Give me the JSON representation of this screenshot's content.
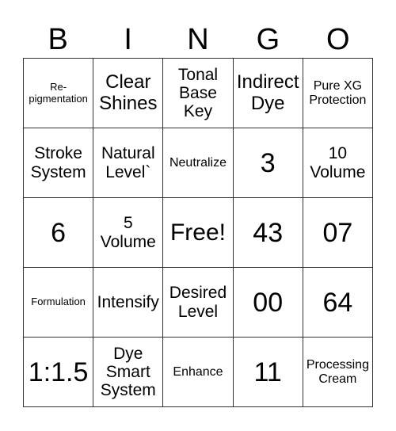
{
  "header": {
    "letters": [
      "B",
      "I",
      "N",
      "G",
      "O"
    ]
  },
  "cells": [
    [
      "Re-\npigmentation",
      "Clear Shines",
      "Tonal Base Key",
      "Indirect Dye",
      "Pure XG Protection"
    ],
    [
      "Stroke System",
      "Natural Level`",
      "Neutralize",
      "3",
      "10 Volume"
    ],
    [
      "6",
      "5 Volume",
      "Free!",
      "43",
      "07"
    ],
    [
      "Formulation",
      "Intensify",
      "Desired Level",
      "00",
      "64"
    ],
    [
      "1:1.5",
      "Dye Smart System",
      "Enhance",
      "11",
      "Processing Cream"
    ]
  ]
}
